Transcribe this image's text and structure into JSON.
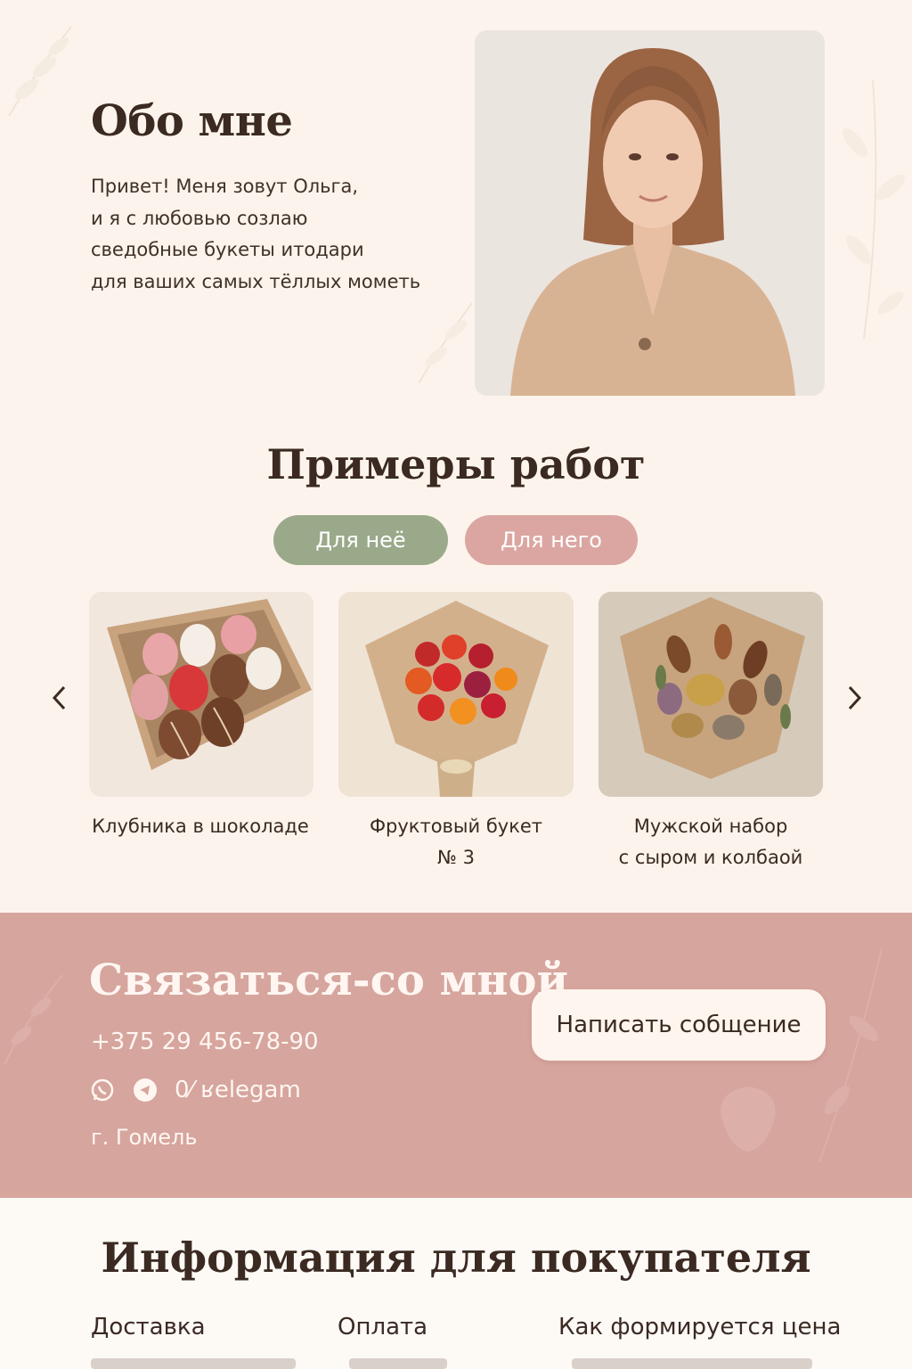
{
  "about": {
    "title": "Обо мне",
    "text_lines": [
      "Привет! Меня зовут Ольга,",
      "и я с любовью созлаю",
      "сведобные букеты итодари",
      "для ваших самых тёллых мометь"
    ]
  },
  "works": {
    "title": "Примеры работ",
    "tabs": [
      "Для неё",
      "Для него"
    ],
    "items": [
      {
        "caption_lines": [
          "Клубника в шоколаде"
        ]
      },
      {
        "caption_lines": [
          "Фруктовый букет",
          "№ 3"
        ]
      },
      {
        "caption_lines": [
          "Мужской набор",
          "с сыром и колбаой"
        ]
      }
    ]
  },
  "contact": {
    "title": "Связаться-со мной",
    "phone": "+375 29 456-78-90",
    "social_text": "0⁄  ʁelegam",
    "city": "г. Гомель",
    "message_button": "Написать собщение",
    "icons": [
      "whatsapp-icon",
      "telegram-icon"
    ]
  },
  "info": {
    "title": "Информация для покупателя",
    "columns": [
      "Доставка",
      "Оплата",
      "Как формируется цена"
    ]
  },
  "colors": {
    "background": "#fcf4ec",
    "tab_her": "#9aa98a",
    "tab_him": "#dba6a1",
    "contact_bg": "#d6a59e"
  }
}
